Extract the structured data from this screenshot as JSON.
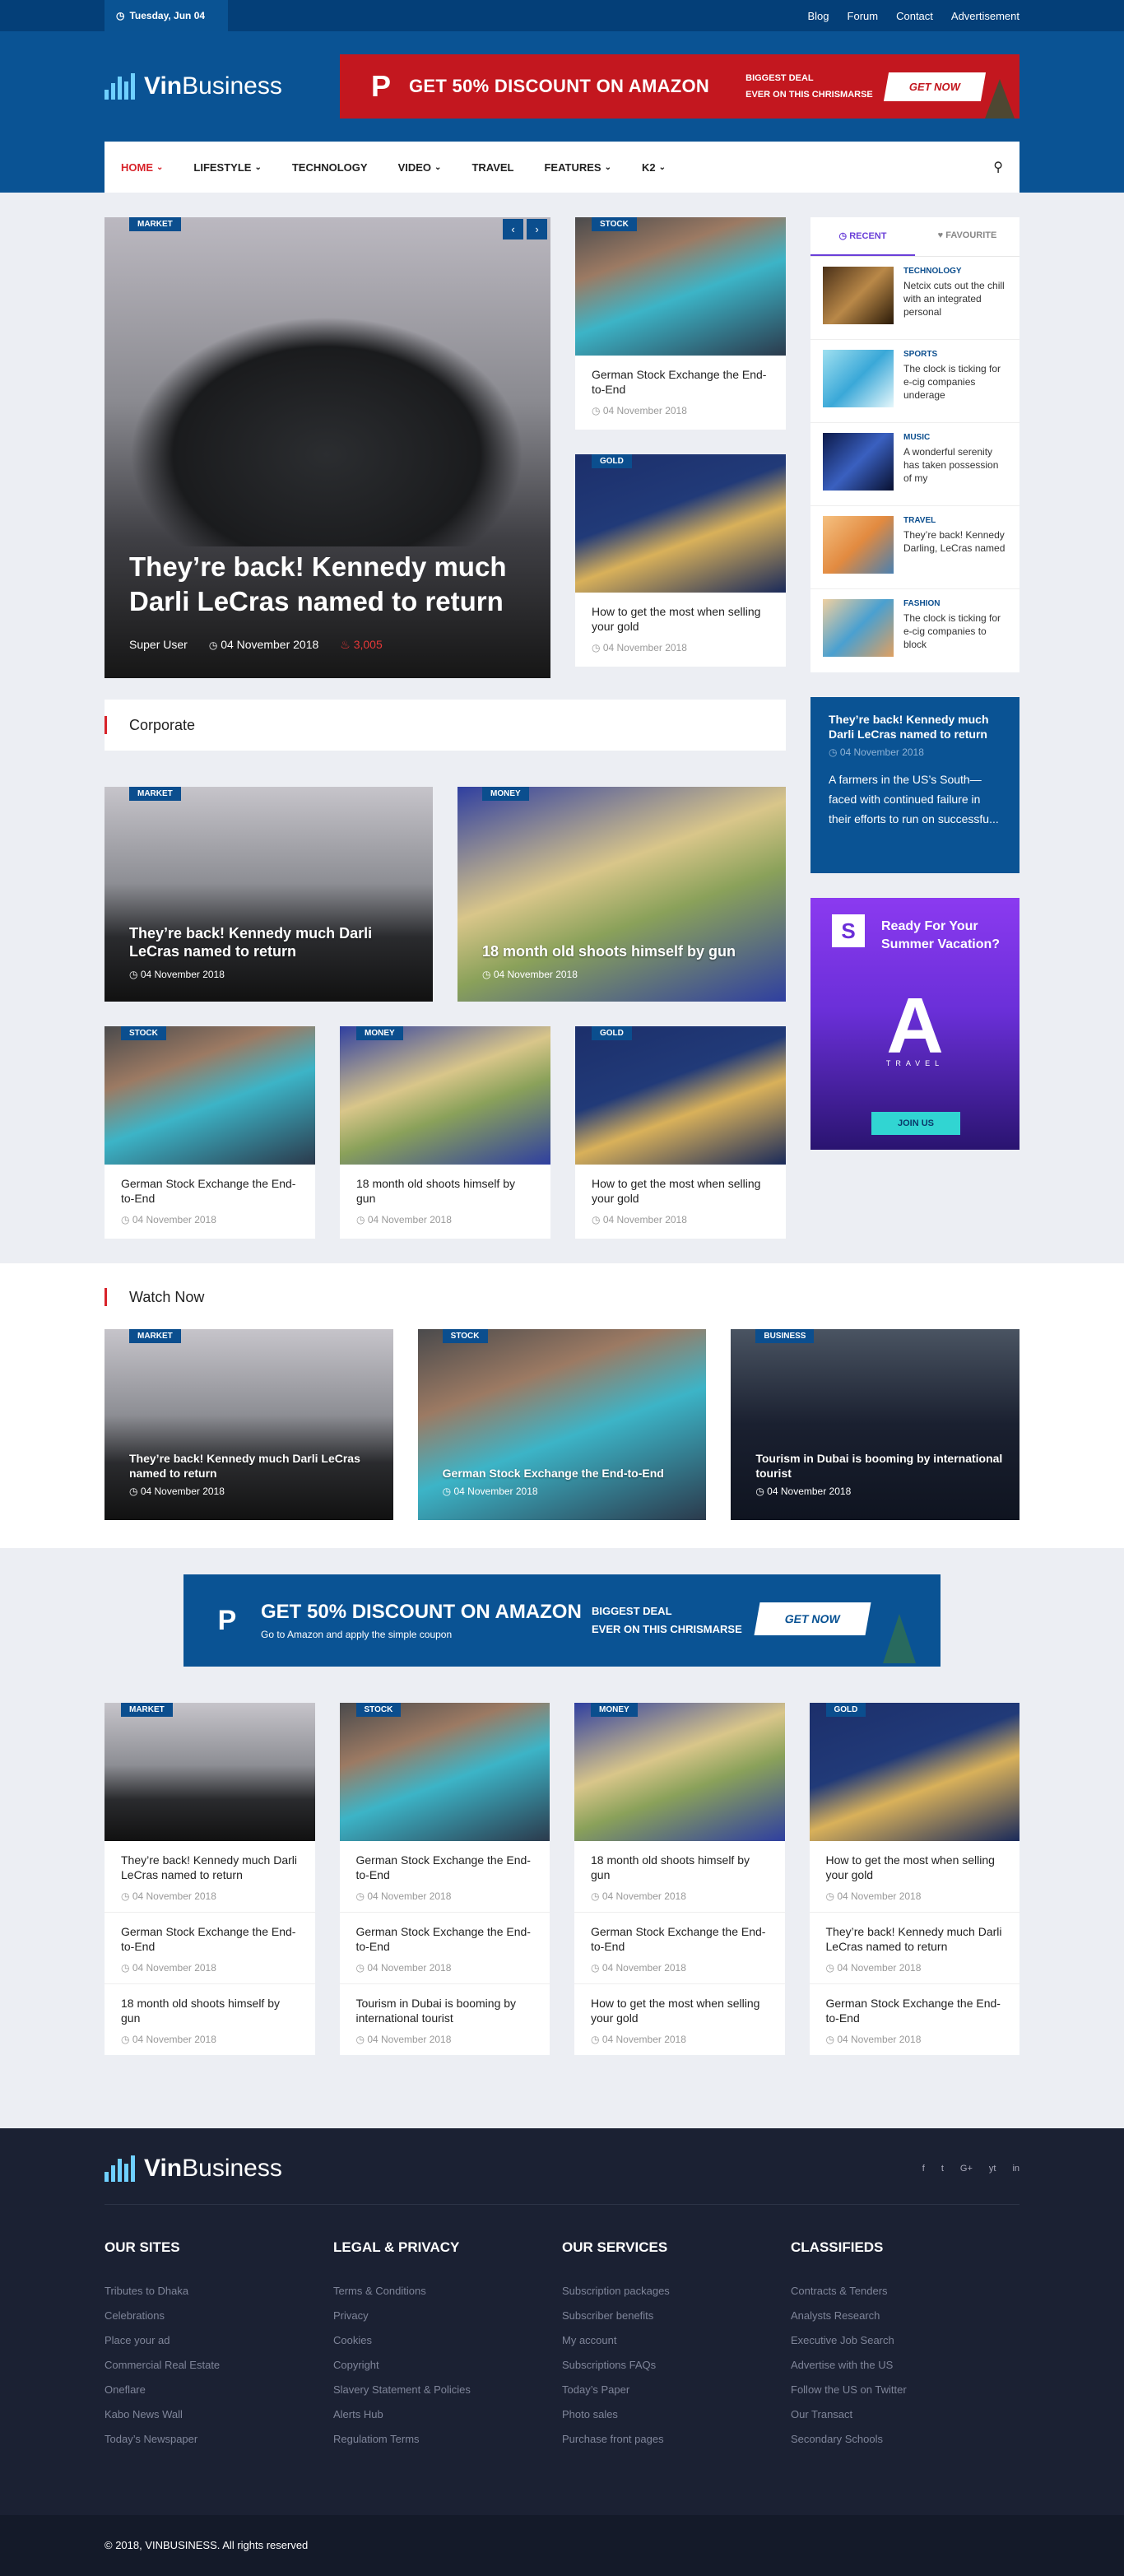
{
  "topbar": {
    "date": "Tuesday, Jun 04",
    "links": [
      "Blog",
      "Forum",
      "Contact",
      "Advertisement"
    ]
  },
  "brand": {
    "name_bold": "Vin",
    "name_rest": "Business"
  },
  "ad_top": {
    "logo": "P",
    "headline": "GET 50% DISCOUNT ON AMAZON",
    "sub1": "BIGGEST DEAL",
    "sub2": "EVER ON THIS CHRISMARSE",
    "button": "GET NOW"
  },
  "nav": {
    "items": [
      "HOME",
      "LIFESTYLE",
      "TECHNOLOGY",
      "VIDEO",
      "TRAVEL",
      "FEATURES",
      "K2"
    ]
  },
  "hero": {
    "category": "MARKET",
    "title": "They’re back! Kennedy much Darli LeCras named to return",
    "author": "Super User",
    "date": "04 November 2018",
    "views": "3,005"
  },
  "top_cards": [
    {
      "category": "STOCK",
      "title": "German Stock Exchange the End-to-End",
      "date": "04 November 2018"
    },
    {
      "category": "GOLD",
      "title": "How to get the most when selling your gold",
      "date": "04 November 2018"
    }
  ],
  "tabs": {
    "recent_label": "RECENT",
    "favourite_label": "FAVOURITE",
    "items": [
      {
        "category": "TECHNOLOGY",
        "title": "Netcix cuts out the chill with an integrated personal"
      },
      {
        "category": "SPORTS",
        "title": "The clock is ticking for e-cig companies underage"
      },
      {
        "category": "MUSIC",
        "title": "A wonderful serenity has taken possession of my"
      },
      {
        "category": "TRAVEL",
        "title": "They’re back! Kennedy Darling, LeCras named"
      },
      {
        "category": "FASHION",
        "title": "The clock is ticking for e-cig companies to block"
      }
    ]
  },
  "blue_box": {
    "title": "They’re back! Kennedy much Darli LeCras named to return",
    "date": "04 November 2018",
    "excerpt": "A farmers in the US’s South—faced with continued failure in their efforts to run on successfu..."
  },
  "promo": {
    "logo": "S",
    "title_line1": "Ready For Your",
    "title_line2": "Summer Vacation?",
    "brand_letter": "A",
    "brand_word": "TRAVEL",
    "button": "JOIN US"
  },
  "corporate": {
    "heading": "Corporate",
    "big": [
      {
        "category": "MARKET",
        "title": "They’re back! Kennedy much Darli LeCras named to return",
        "date": "04 November 2018"
      },
      {
        "category": "MONEY",
        "title": "18 month old shoots himself by gun",
        "date": "04 November 2018"
      }
    ],
    "small": [
      {
        "category": "STOCK",
        "title": "German Stock Exchange the End-to-End",
        "date": "04 November 2018"
      },
      {
        "category": "MONEY",
        "title": "18 month old shoots himself by gun",
        "date": "04 November 2018"
      },
      {
        "category": "GOLD",
        "title": "How to get the most when selling your gold",
        "date": "04 November 2018"
      }
    ]
  },
  "watch": {
    "heading": "Watch Now",
    "items": [
      {
        "category": "MARKET",
        "title": "They’re back! Kennedy much Darli LeCras named to return",
        "date": "04 November 2018"
      },
      {
        "category": "STOCK",
        "title": "German Stock Exchange the End-to-End",
        "date": "04 November 2018"
      },
      {
        "category": "BUSINESS",
        "title": "Tourism in Dubai is booming by international tourist",
        "date": "04 November 2018"
      }
    ]
  },
  "ad_mid": {
    "logo": "P",
    "headline": "GET 50% DISCOUNT ON AMAZON",
    "small": "Go to Amazon and apply the simple coupon",
    "sub1": "BIGGEST DEAL",
    "sub2": "EVER ON THIS CHRISMARSE",
    "button": "GET NOW"
  },
  "lists": [
    {
      "category": "MARKET",
      "items": [
        {
          "title": "They’re back! Kennedy much Darli LeCras named to return",
          "date": "04 November 2018"
        },
        {
          "title": "German Stock Exchange the End-to-End",
          "date": "04 November 2018"
        },
        {
          "title": "18 month old shoots himself by gun",
          "date": "04 November 2018"
        }
      ]
    },
    {
      "category": "STOCK",
      "items": [
        {
          "title": "German Stock Exchange the End-to-End",
          "date": "04 November 2018"
        },
        {
          "title": "German Stock Exchange the End-to-End",
          "date": "04 November 2018"
        },
        {
          "title": "Tourism in Dubai is booming by international tourist",
          "date": "04 November 2018"
        }
      ]
    },
    {
      "category": "MONEY",
      "items": [
        {
          "title": "18 month old shoots himself by gun",
          "date": "04 November 2018"
        },
        {
          "title": "German Stock Exchange the End-to-End",
          "date": "04 November 2018"
        },
        {
          "title": "How to get the most when selling your gold",
          "date": "04 November 2018"
        }
      ]
    },
    {
      "category": "GOLD",
      "items": [
        {
          "title": "How to get the most when selling your gold",
          "date": "04 November 2018"
        },
        {
          "title": "They’re back! Kennedy much Darli LeCras named to return",
          "date": "04 November 2018"
        },
        {
          "title": "German Stock Exchange the End-to-End",
          "date": "04 November 2018"
        }
      ]
    }
  ],
  "footer": {
    "socials": [
      "f",
      "t",
      "G+",
      "yt",
      "in"
    ],
    "columns": [
      {
        "heading": "OUR SITES",
        "links": [
          "Tributes to Dhaka",
          "Celebrations",
          "Place your ad",
          "Commercial Real Estate",
          "Oneflare",
          "Kabo News Wall",
          "Today’s Newspaper"
        ]
      },
      {
        "heading": "LEGAL & PRIVACY",
        "links": [
          "Terms & Conditions",
          "Privacy",
          "Cookies",
          "Copyright",
          "Slavery Statement & Policies",
          "Alerts Hub",
          "Regulatiom Terms"
        ]
      },
      {
        "heading": "OUR SERVICES",
        "links": [
          "Subscription packages",
          "Subscriber benefits",
          "My account",
          "Subscriptions FAQs",
          "Today’s Paper",
          "Photo sales",
          "Purchase front pages"
        ]
      },
      {
        "heading": "CLASSIFIEDS",
        "links": [
          "Contracts & Tenders",
          "Analysts Research",
          "Executive Job Search",
          "Advertise with the US",
          "Follow the US on Twitter",
          "Our Transact",
          "Secondary Schools"
        ]
      }
    ],
    "copyright": "© 2018, VINBUSINESS. All rights reserved"
  },
  "colors": {
    "primary": "#0a5394",
    "accent": "#d8232a",
    "footer": "#1b2133"
  }
}
